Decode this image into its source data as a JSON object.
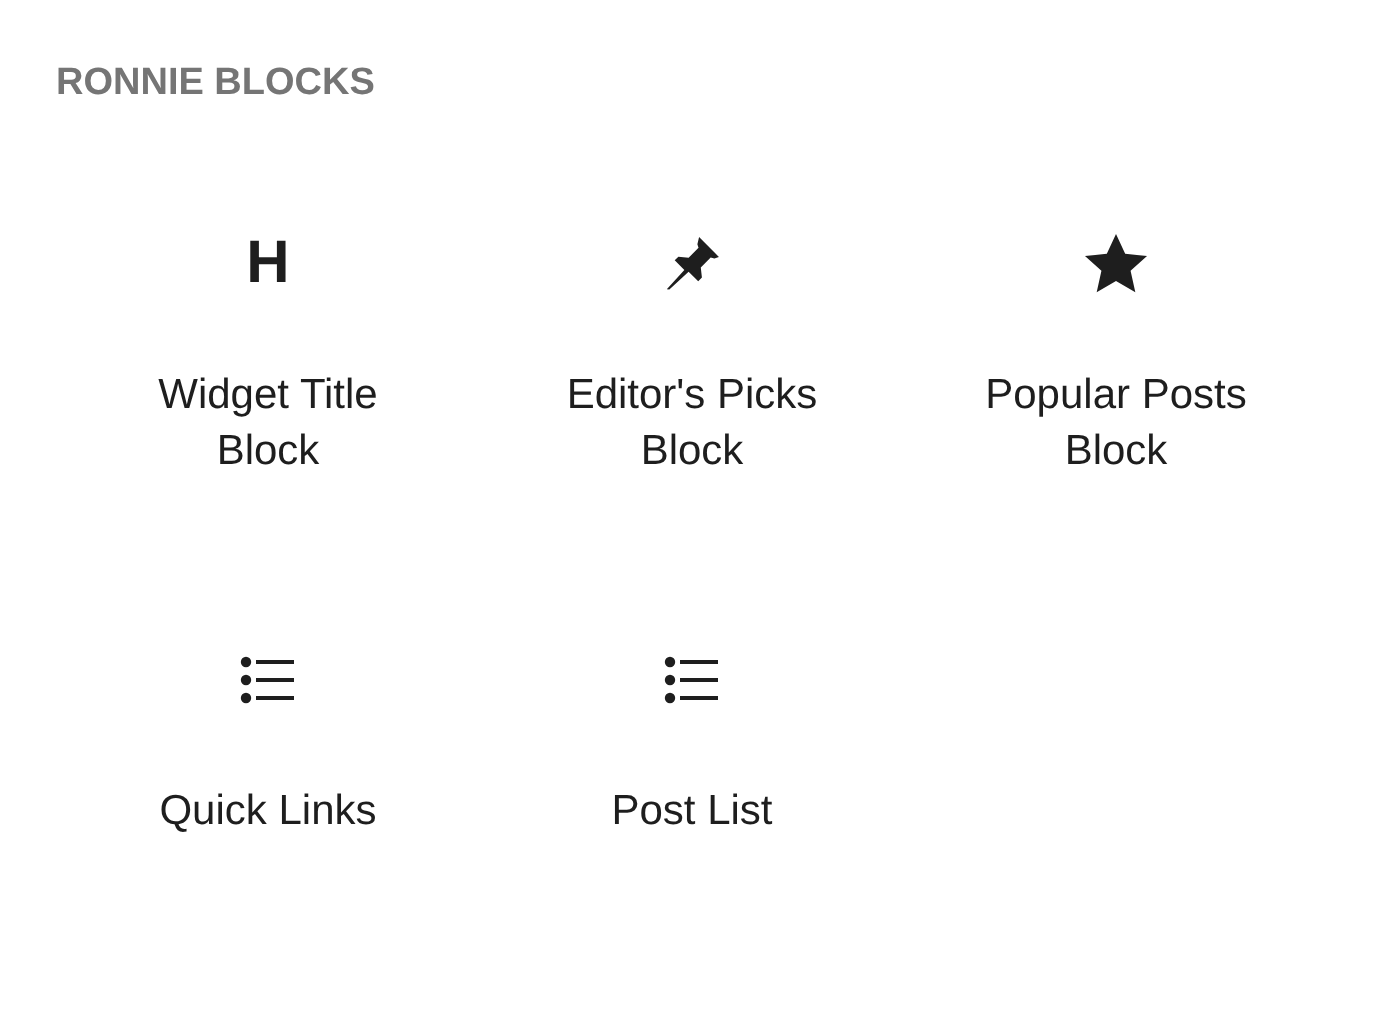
{
  "category": {
    "title": "RONNIE BLOCKS"
  },
  "blocks": [
    {
      "kind": "heading",
      "glyph": "H",
      "label": "Widget Title Block"
    },
    {
      "kind": "pin",
      "label": "Editor's Picks Block"
    },
    {
      "kind": "star",
      "label": "Popular Posts Block"
    },
    {
      "kind": "list",
      "label": "Quick Links"
    },
    {
      "kind": "list",
      "label": "Post List"
    }
  ]
}
